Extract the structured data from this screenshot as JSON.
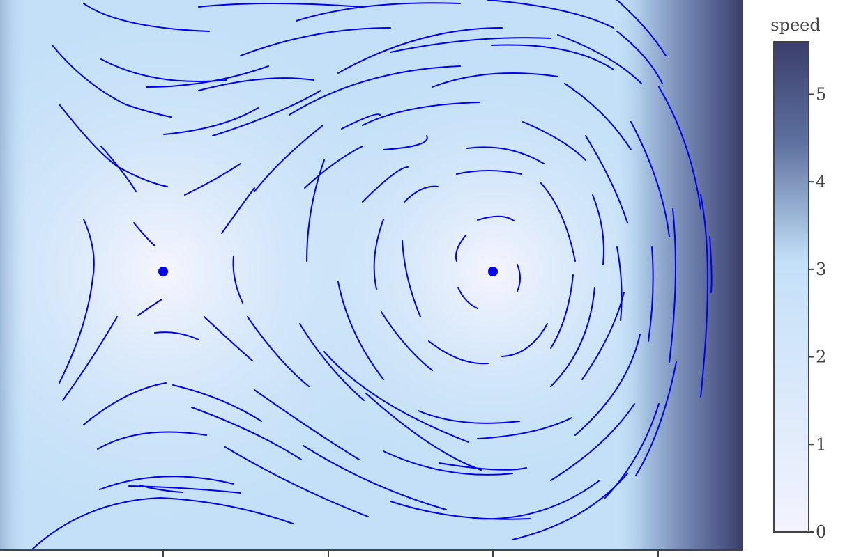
{
  "chart_data": {
    "type": "heatmap",
    "subtype": "streamplot-over-speed-field",
    "colorbar": {
      "title": "speed",
      "range": [
        0,
        5.6
      ],
      "ticks": [
        0,
        1,
        2,
        3,
        4,
        5
      ],
      "tick_labels": [
        "0",
        "1",
        "2",
        "3",
        "4",
        "5"
      ],
      "colors": [
        "#f3f3fd",
        "#c3e0f8",
        "#5c6f9e",
        "#3b3e6c"
      ]
    },
    "x_ticks_visible_labels": [],
    "stagnation_points": [
      {
        "x": -1,
        "y": 0,
        "kind": "saddle"
      },
      {
        "x": 1,
        "y": 0,
        "kind": "center"
      }
    ],
    "stream_color": "#0000ee",
    "marker_color": "#0000ee"
  }
}
